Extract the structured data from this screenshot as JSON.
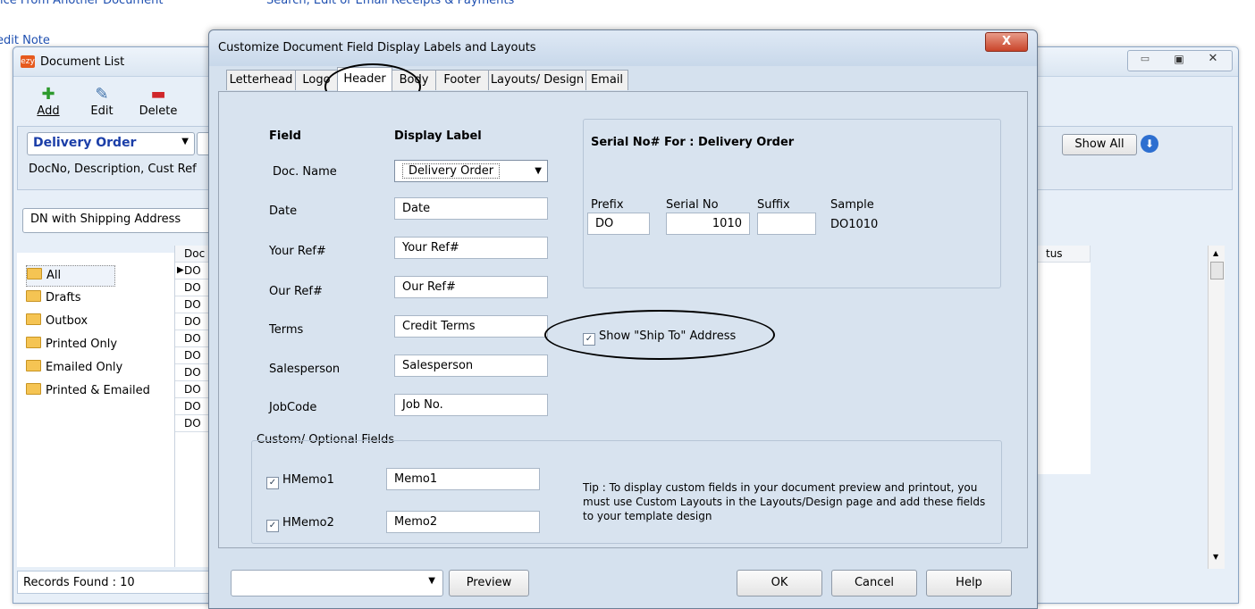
{
  "background": {
    "link1": "oice From Another Document",
    "link2": "Search, Edit or Email Receipts & Payments",
    "link3": "edit Note"
  },
  "doclist": {
    "title": "Document List",
    "toolbar": {
      "add": "Add",
      "edit": "Edit",
      "delete": "Delete"
    },
    "doc_type": "Delivery Order",
    "search_fields": "DocNo, Description, Cust Ref",
    "layout_combo": "DN with Shipping Address",
    "show_all": "Show All",
    "tree": [
      "All",
      "Drafts",
      "Outbox",
      "Printed Only",
      "Emailed Only",
      "Printed & Emailed"
    ],
    "grid_header": "Doc",
    "grid_rows": [
      "DO",
      "DO",
      "DO",
      "DO",
      "DO",
      "DO",
      "DO",
      "DO",
      "DO",
      "DO"
    ],
    "status_header": "tus",
    "records_found": "Records Found : 10"
  },
  "dialog": {
    "title": "Customize Document Field Display Labels and Layouts",
    "close": "X",
    "tabs": [
      "Letterhead",
      "Logo",
      "Header",
      "Body",
      "Footer",
      "Layouts/ Design",
      "Email"
    ],
    "active_tab": "Header",
    "col_field": "Field",
    "col_display": "Display Label",
    "fields": [
      {
        "field": "Doc. Name",
        "label": "Delivery Order"
      },
      {
        "field": "Date",
        "label": "Date"
      },
      {
        "field": "Your Ref#",
        "label": "Your Ref#"
      },
      {
        "field": "Our Ref#",
        "label": "Our Ref#"
      },
      {
        "field": "Terms",
        "label": "Credit Terms"
      },
      {
        "field": "Salesperson",
        "label": "Salesperson"
      },
      {
        "field": "JobCode",
        "label": "Job No."
      }
    ],
    "serial": {
      "title": "Serial No# For : Delivery Order",
      "prefix_label": "Prefix",
      "serial_label": "Serial No",
      "suffix_label": "Suffix",
      "sample_label": "Sample",
      "prefix": "DO",
      "serial": "1010",
      "suffix": "",
      "sample": "DO1010"
    },
    "ship_to": "Show \"Ship To\" Address",
    "custom": {
      "title": "Custom/ Optional Fields",
      "memo1_label": "HMemo1",
      "memo1_value": "Memo1",
      "memo2_label": "HMemo2",
      "memo2_value": "Memo2",
      "tip": "Tip : To display custom fields in your document preview and printout, you must use Custom Layouts in the Layouts/Design page and add these fields to your template design"
    },
    "buttons": {
      "preview": "Preview",
      "ok": "OK",
      "cancel": "Cancel",
      "help": "Help"
    }
  }
}
